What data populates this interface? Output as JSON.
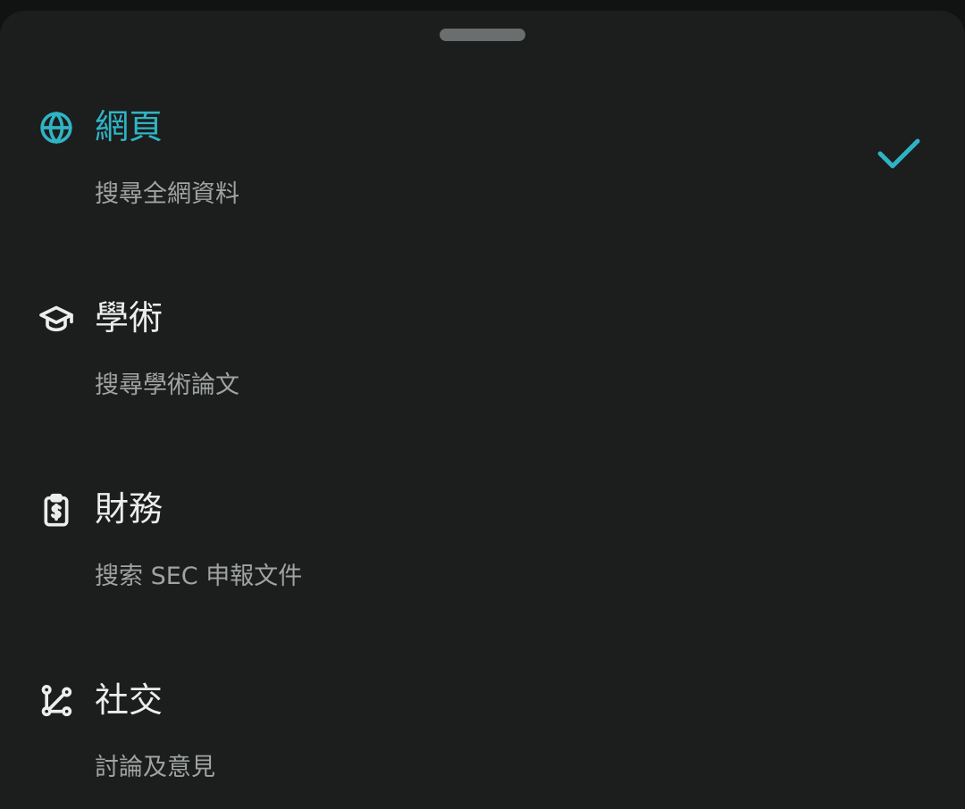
{
  "accent_color": "#2fb4c4",
  "options": [
    {
      "title": "網頁",
      "description": "搜尋全網資料",
      "icon": "globe-icon",
      "selected": true
    },
    {
      "title": "學術",
      "description": "搜尋學術論文",
      "icon": "graduation-cap-icon",
      "selected": false
    },
    {
      "title": "財務",
      "description": "搜索 SEC 申報文件",
      "icon": "clipboard-dollar-icon",
      "selected": false
    },
    {
      "title": "社交",
      "description": "討論及意見",
      "icon": "social-graph-icon",
      "selected": false
    }
  ],
  "selected_indicator_icon": "checkmark-icon"
}
